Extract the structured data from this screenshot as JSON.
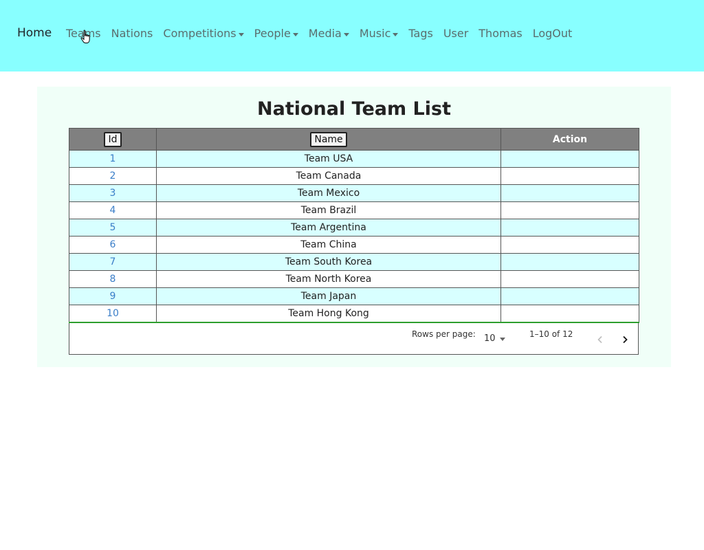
{
  "nav": {
    "brand": "Home",
    "items": [
      {
        "label": "Teams",
        "dropdown": false
      },
      {
        "label": "Nations",
        "dropdown": false
      },
      {
        "label": "Competitions",
        "dropdown": true
      },
      {
        "label": "People",
        "dropdown": true
      },
      {
        "label": "Media",
        "dropdown": true
      },
      {
        "label": "Music",
        "dropdown": true
      },
      {
        "label": "Tags",
        "dropdown": false
      },
      {
        "label": "User",
        "dropdown": false
      },
      {
        "label": "Thomas",
        "dropdown": false
      },
      {
        "label": "LogOut",
        "dropdown": false
      }
    ]
  },
  "page": {
    "title": "National Team List"
  },
  "table": {
    "columns": {
      "id": "Id",
      "name": "Name",
      "action": "Action"
    },
    "rows": [
      {
        "id": "1",
        "name": "Team USA"
      },
      {
        "id": "2",
        "name": "Team Canada"
      },
      {
        "id": "3",
        "name": "Team Mexico"
      },
      {
        "id": "4",
        "name": "Team Brazil"
      },
      {
        "id": "5",
        "name": "Team Argentina"
      },
      {
        "id": "6",
        "name": "Team China"
      },
      {
        "id": "7",
        "name": "Team South Korea"
      },
      {
        "id": "8",
        "name": "Team North Korea"
      },
      {
        "id": "9",
        "name": "Team Japan"
      },
      {
        "id": "10",
        "name": "Team Hong Kong"
      }
    ]
  },
  "pagination": {
    "rows_per_page_label": "Rows per page:",
    "rows_per_page_value": "10",
    "range": "1–10 of 12"
  },
  "colors": {
    "navbar_bg": "#88ffff",
    "panel_bg": "#f0fff8",
    "header_bg": "#808080",
    "odd_row_bg": "#d8ffff",
    "link": "#3a7ec8"
  },
  "icons": {
    "pointer": "hand-pointer-icon",
    "prev": "chevron-left-icon",
    "next": "chevron-right-icon"
  }
}
